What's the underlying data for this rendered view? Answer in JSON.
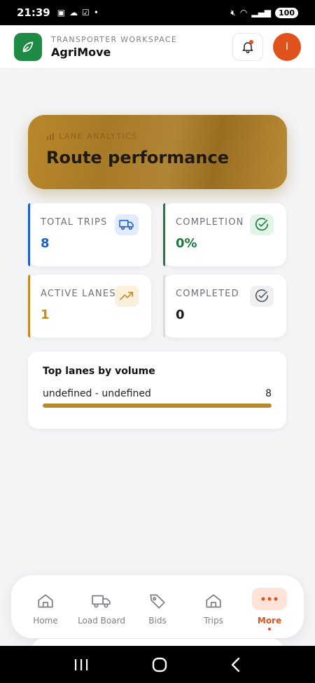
{
  "status_bar": {
    "time": "21:39",
    "battery": "100",
    "left_icons": [
      "screenshot-icon",
      "cloud-icon",
      "checkbox-icon",
      "dot-icon"
    ],
    "right_icons": [
      "mute-icon",
      "wifi-icon",
      "signal-icon",
      "battery-icon"
    ]
  },
  "header": {
    "workspace_label": "TRANSPORTER WORKSPACE",
    "app_name": "AgriMove",
    "logo_icon": "leaf-icon",
    "notifications_icon": "bell-icon",
    "avatar_initial": "I",
    "brand_color": "#1e8a44",
    "accent_color": "#e0521b"
  },
  "hero": {
    "eyebrow": "LANE ANALYTICS",
    "title": "Route performance",
    "icon": "chart-icon"
  },
  "stats": [
    {
      "label": "TOTAL TRIPS",
      "value": "8",
      "icon": "truck-icon",
      "color": "#1f5fc4"
    },
    {
      "label": "COMPLETION",
      "value": "0%",
      "icon": "check-circle-icon",
      "color": "#1f7a3d"
    },
    {
      "label": "ACTIVE LANES",
      "value": "1",
      "icon": "trending-up-icon",
      "color": "#c48a24"
    },
    {
      "label": "COMPLETED",
      "value": "0",
      "icon": "check-circle-icon",
      "color": "#555a62"
    }
  ],
  "top_lanes": {
    "title": "Top lanes by volume",
    "lanes": [
      {
        "name": "undefined - undefined",
        "count": "8",
        "fill_fraction": 1.0
      }
    ]
  },
  "bottom_nav": {
    "items": [
      {
        "label": "Home",
        "icon": "home-icon",
        "active": false
      },
      {
        "label": "Load Board",
        "icon": "truck-icon",
        "active": false
      },
      {
        "label": "Bids",
        "icon": "tag-icon",
        "active": false
      },
      {
        "label": "Trips",
        "icon": "home-icon",
        "active": false
      },
      {
        "label": "More",
        "icon": "more-dots-icon",
        "active": true
      }
    ]
  },
  "system_nav": [
    "recents-icon",
    "home-circle-icon",
    "back-icon"
  ]
}
